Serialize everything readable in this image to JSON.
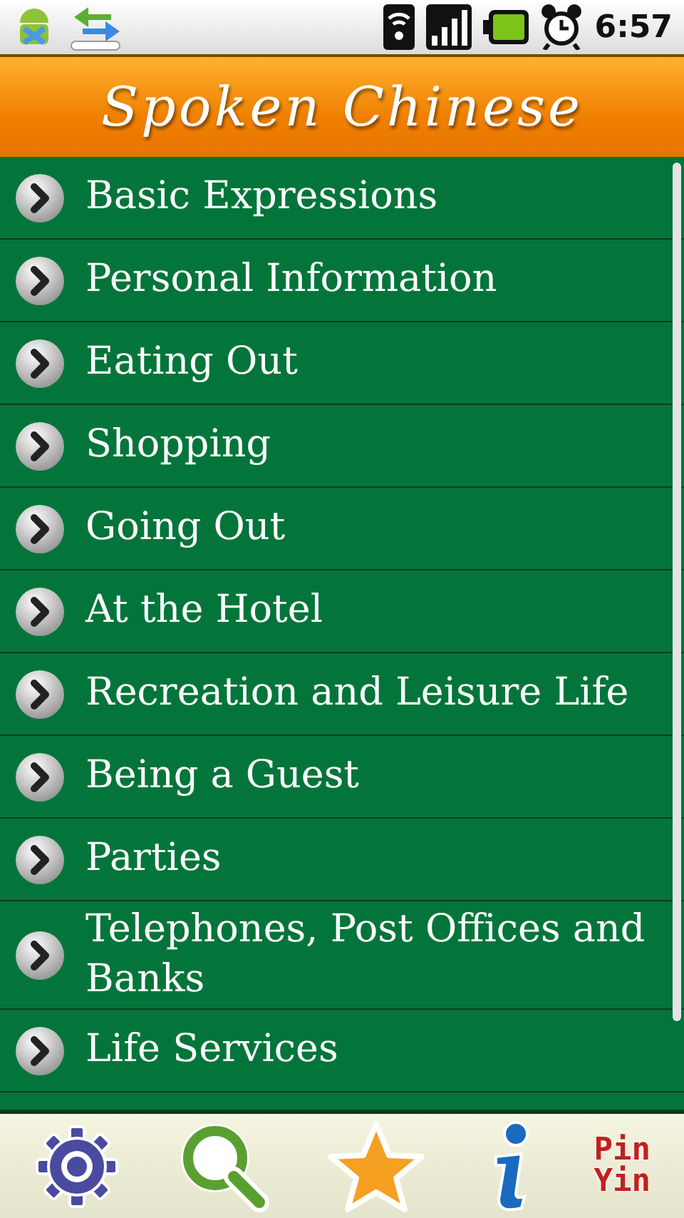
{
  "status_bar": {
    "time": "6:57"
  },
  "header": {
    "title": "Spoken Chinese"
  },
  "topics": [
    {
      "label": "Basic Expressions"
    },
    {
      "label": "Personal Information"
    },
    {
      "label": "Eating Out"
    },
    {
      "label": "Shopping"
    },
    {
      "label": "Going Out"
    },
    {
      "label": "At the Hotel"
    },
    {
      "label": "Recreation and Leisure Life"
    },
    {
      "label": "Being a Guest"
    },
    {
      "label": "Parties"
    },
    {
      "label": "Telephones, Post Offices and Banks"
    },
    {
      "label": "Life Services"
    }
  ],
  "toolbar": [
    {
      "kind": "settings"
    },
    {
      "kind": "search"
    },
    {
      "kind": "favorites"
    },
    {
      "kind": "info"
    },
    {
      "kind": "pinyin",
      "lines": [
        "Pin",
        "Yin"
      ]
    }
  ]
}
